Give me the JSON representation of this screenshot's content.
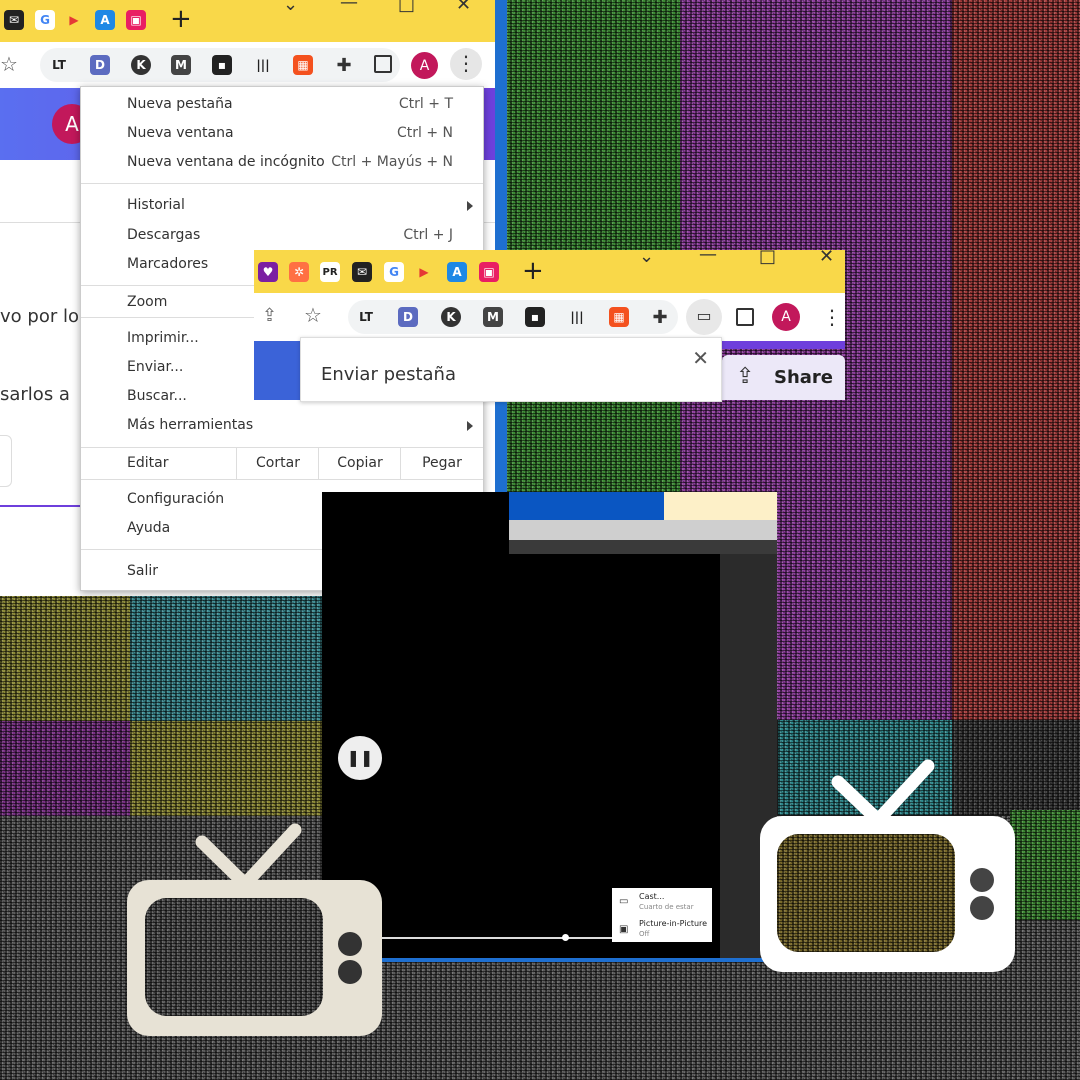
{
  "menu": {
    "items_group1": [
      {
        "label": "Nueva pestaña",
        "shortcut": "Ctrl + T"
      },
      {
        "label": "Nueva ventana",
        "shortcut": "Ctrl + N"
      },
      {
        "label": "Nueva ventana de incógnito",
        "shortcut": "Ctrl + Mayús + N"
      }
    ],
    "items_group2": [
      {
        "label": "Historial"
      },
      {
        "label": "Descargas",
        "shortcut": "Ctrl + J"
      },
      {
        "label": "Marcadores"
      }
    ],
    "zoom": "Zoom",
    "items_group3": [
      {
        "label": "Imprimir..."
      },
      {
        "label": "Enviar..."
      },
      {
        "label": "Buscar..."
      },
      {
        "label": "Más herramientas"
      }
    ],
    "edit": {
      "label": "Editar",
      "cut": "Cortar",
      "copy": "Copiar",
      "paste": "Pegar"
    },
    "items_group4": [
      {
        "label": "Configuración"
      },
      {
        "label": "Ayuda"
      }
    ],
    "exit": "Salir"
  },
  "page_behind": {
    "avatar_letter": "A",
    "text_line1": "vo por lo",
    "text_line2": "sarlos a"
  },
  "toolbar": {
    "avatar_letter": "A"
  },
  "cast_window": {
    "avatar_letter": "A",
    "popup_title": "Enviar pestaña",
    "share_label": "Share"
  },
  "video_menu": {
    "cast_label": "Cast...",
    "cast_sub": "Cuarto de estar",
    "pip_label": "Picture-in-Picture",
    "pip_sub": "Off"
  },
  "colors": {
    "tabstrip": "#f9d849",
    "accent_purple": "#6e3fdc",
    "tv_fill": "#e7e2d5",
    "avatar": "#c2185b"
  }
}
